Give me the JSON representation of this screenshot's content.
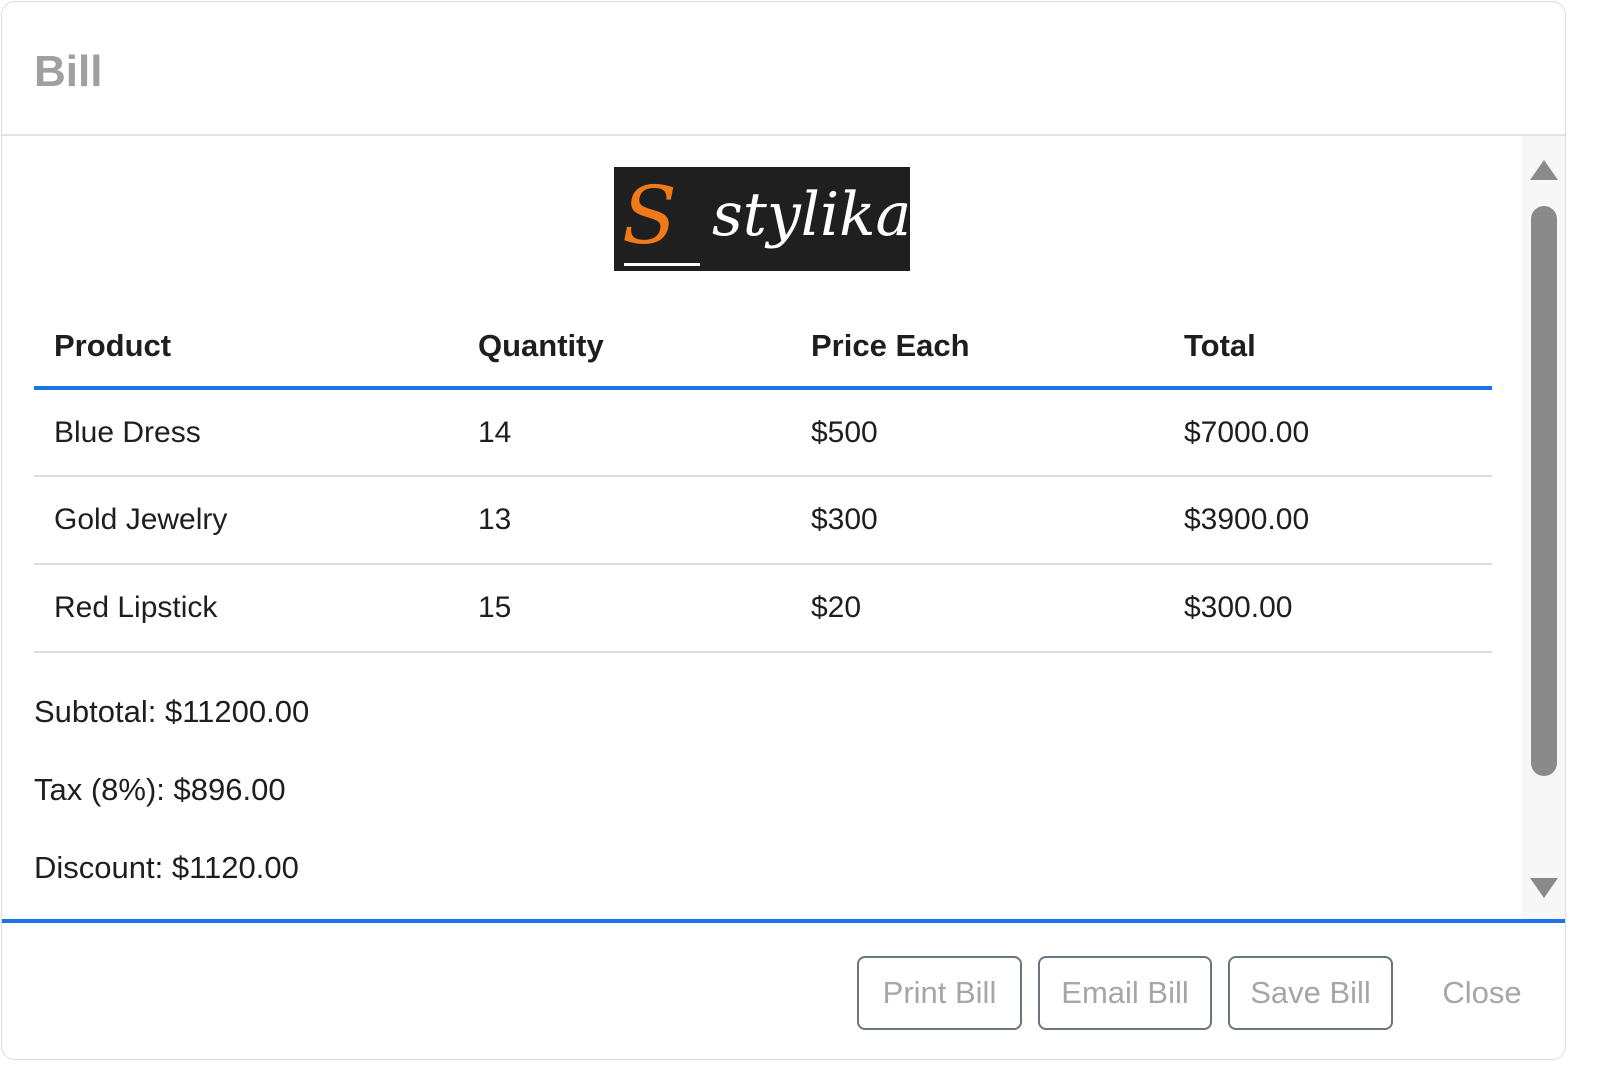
{
  "modal": {
    "title": "Bill"
  },
  "logo": {
    "mark": "S",
    "text": "stylika",
    "colors": {
      "background": "#1f1f1f",
      "mark": "#f07a1a",
      "text": "#ffffff"
    }
  },
  "table": {
    "headers": [
      "Product",
      "Quantity",
      "Price Each",
      "Total"
    ],
    "rows": [
      [
        "Blue Dress",
        "14",
        "$500",
        "$7000.00"
      ],
      [
        "Gold Jewelry",
        "13",
        "$300",
        "$3900.00"
      ],
      [
        "Red Lipstick",
        "15",
        "$20",
        "$300.00"
      ]
    ]
  },
  "summary": {
    "subtotal": "Subtotal: $11200.00",
    "tax": "Tax (8%): $896.00",
    "discount": "Discount: $1120.00"
  },
  "footer": {
    "print": "Print Bill",
    "email": "Email Bill",
    "save": "Save Bill",
    "close": "Close"
  },
  "colors": {
    "accent": "#1a73e8",
    "title": "#a0a0a0",
    "button_text": "#a6a6a6"
  }
}
